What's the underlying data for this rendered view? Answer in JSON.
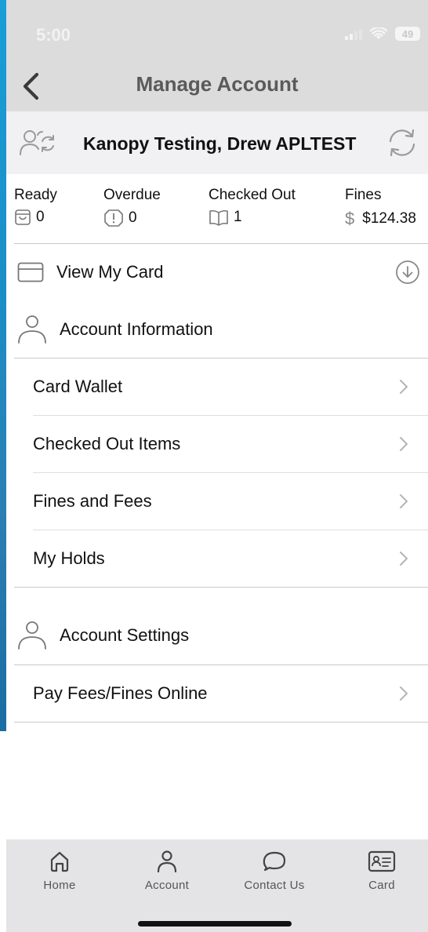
{
  "status": {
    "time": "5:00",
    "battery": "49"
  },
  "nav": {
    "title": "Manage Account"
  },
  "patron": {
    "name": "Kanopy Testing, Drew APLTEST"
  },
  "summary": {
    "ready": {
      "label": "Ready",
      "value": "0"
    },
    "overdue": {
      "label": "Overdue",
      "value": "0"
    },
    "checked_out": {
      "label": "Checked Out",
      "value": "1"
    },
    "fines": {
      "label": "Fines",
      "value": "$124.38"
    }
  },
  "view_card": {
    "label": "View My Card"
  },
  "account_info": {
    "label": "Account Information",
    "items": [
      {
        "label": "Card Wallet"
      },
      {
        "label": "Checked Out Items"
      },
      {
        "label": "Fines and Fees"
      },
      {
        "label": "My Holds"
      }
    ]
  },
  "account_settings": {
    "label": "Account Settings",
    "items": [
      {
        "label": "Pay Fees/Fines Online"
      }
    ]
  },
  "tabbar": {
    "items": [
      {
        "label": "Home",
        "icon": "home-icon"
      },
      {
        "label": "Account",
        "icon": "account-icon"
      },
      {
        "label": "Contact Us",
        "icon": "chat-bubble-icon"
      },
      {
        "label": "Card",
        "icon": "id-card-icon"
      }
    ]
  }
}
